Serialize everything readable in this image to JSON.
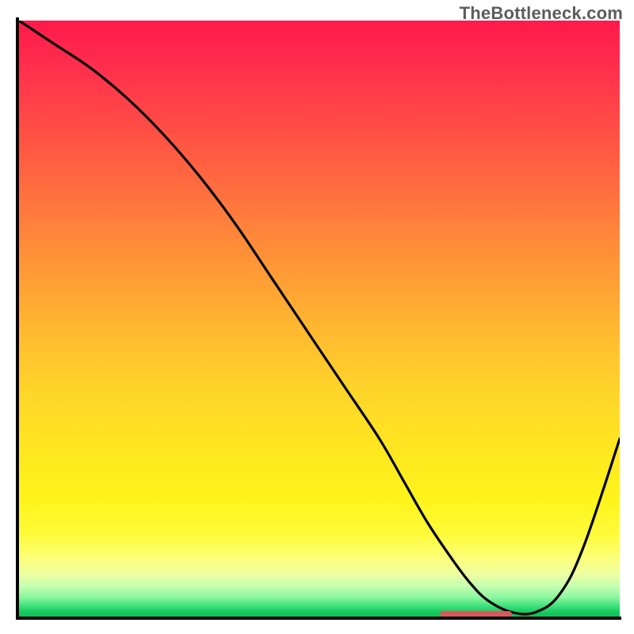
{
  "watermark": "TheBottleneck.com",
  "colors": {
    "curve": "#000000",
    "marker": "#d55a5d",
    "frame": "#000000"
  },
  "chart_data": {
    "type": "line",
    "title": "",
    "xlabel": "",
    "ylabel": "",
    "xlim": [
      0,
      100
    ],
    "ylim": [
      0,
      100
    ],
    "x": [
      0,
      6,
      12,
      18,
      24,
      30,
      36,
      42,
      48,
      54,
      60,
      64,
      68,
      72,
      75,
      78,
      82,
      86,
      90,
      94,
      100
    ],
    "values": [
      100,
      96,
      92,
      87,
      81,
      74,
      66,
      57,
      48,
      39,
      30,
      23,
      16,
      10,
      6,
      3,
      1,
      1,
      4,
      12,
      30
    ],
    "marker": {
      "x_start": 70,
      "x_end": 82,
      "y": 0.6
    },
    "grid": false,
    "legend": false
  }
}
